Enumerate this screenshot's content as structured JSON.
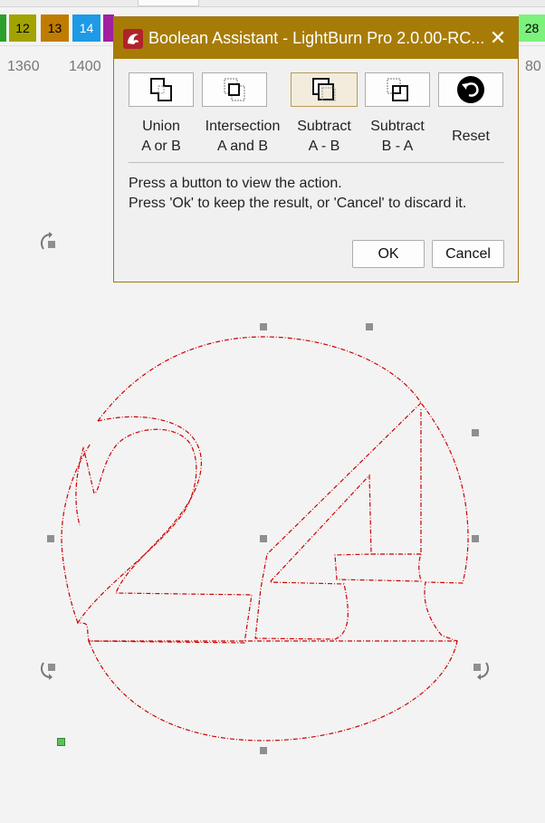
{
  "palette": [
    {
      "label": "",
      "color": "#2aa02a"
    },
    {
      "label": "12",
      "color": "#a3a300"
    },
    {
      "label": "13",
      "color": "#c07c00"
    },
    {
      "label": "14",
      "color": "#1e9ae6"
    },
    {
      "label": "",
      "color": "#a020a0"
    },
    {
      "label": "28",
      "color": "#7cf27c"
    }
  ],
  "ruler": {
    "left": "1360",
    "mid": "1400",
    "right": "80"
  },
  "dialog": {
    "title": "Boolean Assistant - LightBurn Pro 2.0.00-RC...",
    "close_glyph": "✕",
    "operations": [
      {
        "line1": "Union",
        "line2": "A or B",
        "icon": "union-icon"
      },
      {
        "line1": "Intersection",
        "line2": "A and B",
        "icon": "intersection-icon"
      },
      {
        "line1": "Subtract",
        "line2": "A - B",
        "icon": "subtract-a-b-icon"
      },
      {
        "line1": "Subtract",
        "line2": "B - A",
        "icon": "subtract-b-a-icon"
      },
      {
        "line1": "Reset",
        "line2": "",
        "icon": "reset-icon"
      }
    ],
    "message": "Press a button to view the action.\nPress 'Ok' to keep the result, or 'Cancel' to discard it.",
    "ok_label": "OK",
    "cancel_label": "Cancel"
  },
  "colors": {
    "title_bar": "#a77c06",
    "path_stroke": "#cc0000",
    "handle": "#8f8f8f",
    "pivot": "#5fbf5f"
  }
}
